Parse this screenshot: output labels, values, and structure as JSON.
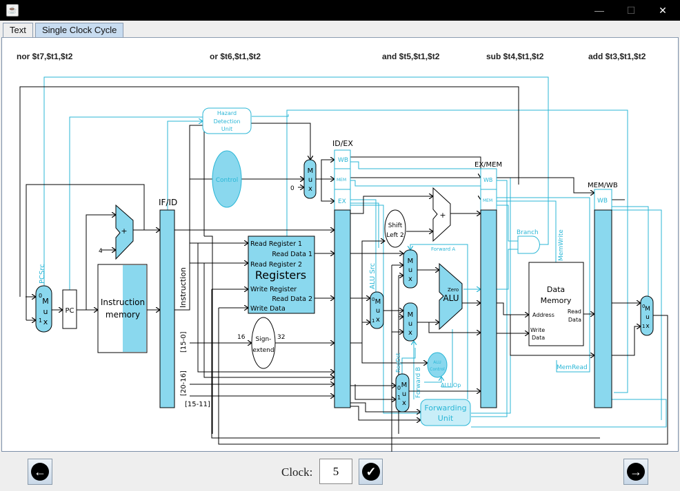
{
  "window": {
    "minimize": "—",
    "maximize": "☐",
    "close": "✕"
  },
  "tabs": [
    {
      "label": "Text",
      "active": false
    },
    {
      "label": "Single Clock Cycle",
      "active": true
    }
  ],
  "instructions": {
    "if": "nor $t7,$t1,$t2",
    "id": "or $t6,$t1,$t2",
    "ex": "and $t5,$t1,$t2",
    "mem": "sub $t4,$t1,$t2",
    "wb": "add $t3,$t1,$t2"
  },
  "diagram": {
    "colors": {
      "wire_control": "#29b6d6",
      "fill": "#8ad8ee",
      "wire_data": "#000000"
    },
    "pcsrc": "PCSrc",
    "mux_m": "M",
    "mux_u": "u",
    "mux_x": "x",
    "zero": "0",
    "one": "1",
    "pc": "PC",
    "four": "4",
    "plus": "+",
    "imem": [
      "Instruction",
      "memory"
    ],
    "ifid": "IF/ID",
    "idex": "ID/EX",
    "exmem": "EX/MEM",
    "memwb": "MEM/WB",
    "hazard": [
      "Hazard",
      "Detection",
      "Unit"
    ],
    "control": "Control",
    "wb": "WB",
    "mem": "MEM",
    "ex": "EX",
    "instruction": "Instruction",
    "bits_15_0": "[15-0]",
    "bits_20_16": "[20-16]",
    "bits_15_11": "[15-11]",
    "registers": {
      "title": "Registers",
      "rr1": "Read Register 1",
      "rr2": "Read Register 2",
      "wr": "Write Register",
      "wd": "Write Data",
      "rd1": "Read Data 1",
      "rd2": "Read Data 2"
    },
    "signext": [
      "Sign-",
      "extend"
    ],
    "w16": "16",
    "w32": "32",
    "shift": [
      "Shift",
      "Left 2"
    ],
    "alusrc": "ALU Src",
    "forward_a": "Forward A",
    "forward_b": "Forward B",
    "alu": "ALU",
    "alu_zero": "Zero",
    "alucontrol": [
      "ALU",
      "Control"
    ],
    "aluop": "ALU Op",
    "regdst": "RegDst",
    "forwarding": [
      "Forwarding",
      "Unit"
    ],
    "branch": "Branch",
    "memwrite": "MemWrite",
    "memread": "MemRead",
    "dmem": {
      "title": [
        "Data",
        "Memory"
      ],
      "address": "Address",
      "write": [
        "Write",
        "Data"
      ],
      "read": [
        "Read",
        "Data"
      ]
    }
  },
  "footer": {
    "clock_label": "Clock:",
    "clock_value": "5",
    "prev": "previous-arrow-icon",
    "next": "next-arrow-icon",
    "go": "check-icon"
  }
}
